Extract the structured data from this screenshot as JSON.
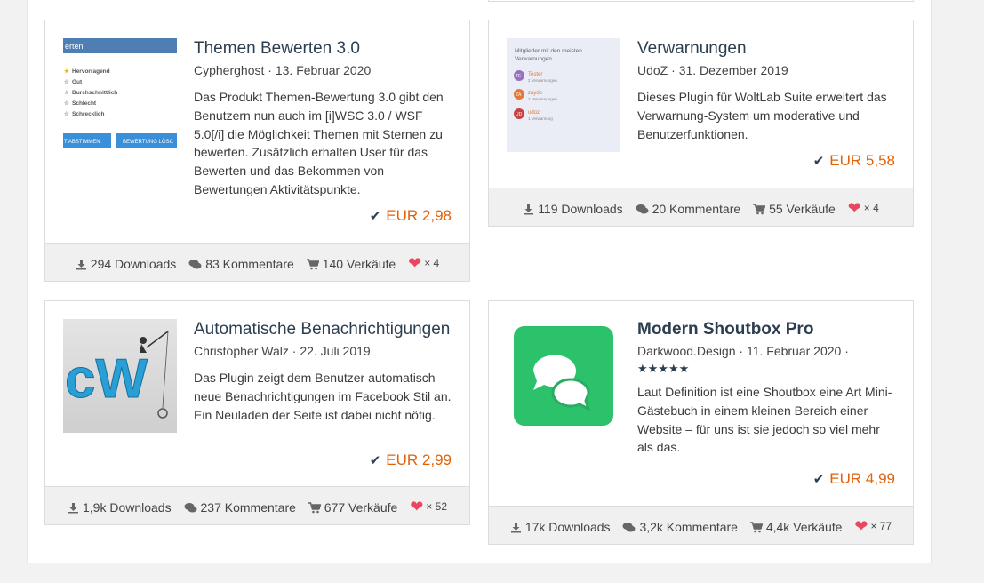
{
  "cards": [
    {
      "title": "Themen Bewerten 3.0",
      "author": "Cypherghost",
      "date": "13. Februar 2020",
      "description": "Das Produkt Themen-Bewertung 3.0 gibt den Benutzern nun auch im [i]WSC 3.0 / WSF 5.0[/i] die Möglichkeit Themen mit Sternen zu bewerten. Zusätzlich erhalten User für das Bewerten und das Bekommen von Bewertungen Aktivitätspunkte.",
      "price": "EUR 2,98",
      "downloads": "294 Downloads",
      "comments": "83 Kommentare",
      "sales": "140 Verkäufe",
      "likes": "× 4",
      "thumb": {
        "header": "erten",
        "options": [
          "Hervorragend",
          "Gut",
          "Durchschnittlich",
          "Schlecht",
          "Schrecklich"
        ],
        "button1": "T ABSTIMMEN",
        "button2": "BEWERTUNG LÖSC"
      }
    },
    {
      "title": "Verwarnungen",
      "author": "UdoZ",
      "date": "31. Dezember 2019",
      "description": "Dieses Plugin für WoltLab Suite erweitert das Verwarnung-System um moderative und Benutzerfunktionen.",
      "price": "EUR 5,58",
      "downloads": "119 Downloads",
      "comments": "20 Kommentare",
      "sales": "55 Verkäufe",
      "likes": "× 4",
      "thumb": {
        "header": "Mitglieder mit den meisten Verwarnungen",
        "users": [
          {
            "initials": "TE",
            "name": "Tester",
            "sub": "2 Verwarnungen",
            "color": "#9b6fc0"
          },
          {
            "initials": "ZA",
            "name": "zaydo",
            "sub": "2 Verwarnungen",
            "color": "#e07a3a"
          },
          {
            "initials": "UD",
            "name": "udoz",
            "sub": "1 Verwarnung",
            "color": "#c84040"
          }
        ]
      }
    },
    {
      "title": "Automatische Benachrichtigungen",
      "author": "Christopher Walz",
      "date": "22. Juli 2019",
      "description": "Das Plugin zeigt dem Benutzer automatisch neue Benachrichtigungen im Facebook Stil an. Ein Neuladen der Seite ist dabei nicht nötig.",
      "price": "EUR 2,99",
      "downloads": "1,9k Downloads",
      "comments": "237 Kommentare",
      "sales": "677 Verkäufe",
      "likes": "× 52",
      "thumb": {
        "logo": "cW"
      }
    },
    {
      "title": "Modern Shoutbox Pro",
      "author": "Darkwood.Design",
      "date": "11. Februar 2020",
      "rating": "★★★★★",
      "description": "Laut Definition ist eine Shoutbox eine Art Mini-Gästebuch in einem kleinen Bereich einer Website – für uns ist sie jedoch so viel mehr als das.",
      "price": "EUR 4,99",
      "downloads": "17k Downloads",
      "comments": "3,2k Kommentare",
      "sales": "4,4k Verkäufe",
      "likes": "× 77"
    }
  ],
  "colors": {
    "accent": "#e0620b",
    "title": "#2c3e50",
    "heart": "#e8475f",
    "shoutbox": "#2ecc71"
  }
}
